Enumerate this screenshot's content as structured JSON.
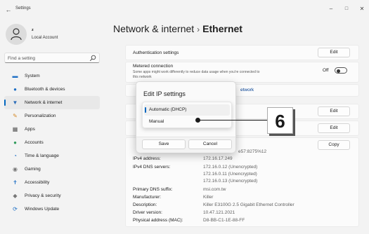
{
  "window": {
    "title": "Settings",
    "controls": {
      "minimize": "–",
      "maximize": "□",
      "close": "✕"
    }
  },
  "profile": {
    "name": "z",
    "account_type": "Local Account"
  },
  "search": {
    "placeholder": "Find a setting"
  },
  "nav": {
    "active_index": 2,
    "items": [
      {
        "label": "System",
        "icon": "monitor-icon"
      },
      {
        "label": "Bluetooth & devices",
        "icon": "bluetooth-icon"
      },
      {
        "label": "Network & internet",
        "icon": "wifi-icon"
      },
      {
        "label": "Personalization",
        "icon": "brush-icon"
      },
      {
        "label": "Apps",
        "icon": "apps-icon"
      },
      {
        "label": "Accounts",
        "icon": "person-icon"
      },
      {
        "label": "Time & language",
        "icon": "globe-clock-icon"
      },
      {
        "label": "Gaming",
        "icon": "gamepad-icon"
      },
      {
        "label": "Accessibility",
        "icon": "accessibility-icon"
      },
      {
        "label": "Privacy & security",
        "icon": "shield-icon"
      },
      {
        "label": "Windows Update",
        "icon": "update-icon"
      }
    ]
  },
  "header": {
    "parent": "Network & internet",
    "separator": "›",
    "current": "Ethernet"
  },
  "settings": {
    "auth_label": "Authentication settings",
    "auth_button": "Edit",
    "metered_label": "Metered connection",
    "metered_desc_1": "Some apps might work differently to reduce data usage when you're connected to",
    "metered_desc_2": "this network",
    "metered_state": "Off",
    "partial_link": "etwork",
    "ip_edit_button": "Edit",
    "dns_edit_button": "Edit",
    "copy_button": "Copy",
    "ipv6_partial": "e57:8275%12"
  },
  "properties": [
    {
      "label": "IPv4 address:",
      "value": "172.16.17.249"
    },
    {
      "label": "IPv4 DNS servers:",
      "value": "172.16.0.12 (Unencrypted)"
    },
    {
      "label": "",
      "value": "172.16.0.11 (Unencrypted)"
    },
    {
      "label": "",
      "value": "172.16.0.13 (Unencrypted)"
    },
    {
      "label": "Primary DNS suffix:",
      "value": "msi.com.tw"
    },
    {
      "label": "Manufacturer:",
      "value": "Killer"
    },
    {
      "label": "Description:",
      "value": "Killer E3100G 2.5 Gigabit Ethernet Controller"
    },
    {
      "label": "Driver version:",
      "value": "10.47.121.2021"
    },
    {
      "label": "Physical address (MAC):",
      "value": "D8-BB-C1-1E-88-FF"
    }
  ],
  "dialog": {
    "title": "Edit IP settings",
    "options": [
      "Automatic (DHCP)",
      "Manual"
    ],
    "selected": "Automatic (DHCP)",
    "save": "Save",
    "cancel": "Cancel"
  },
  "callout": {
    "number": "6"
  },
  "colors": {
    "accent": "#0067c0",
    "background": "#f3f3f3",
    "card": "#fbfbfb"
  }
}
